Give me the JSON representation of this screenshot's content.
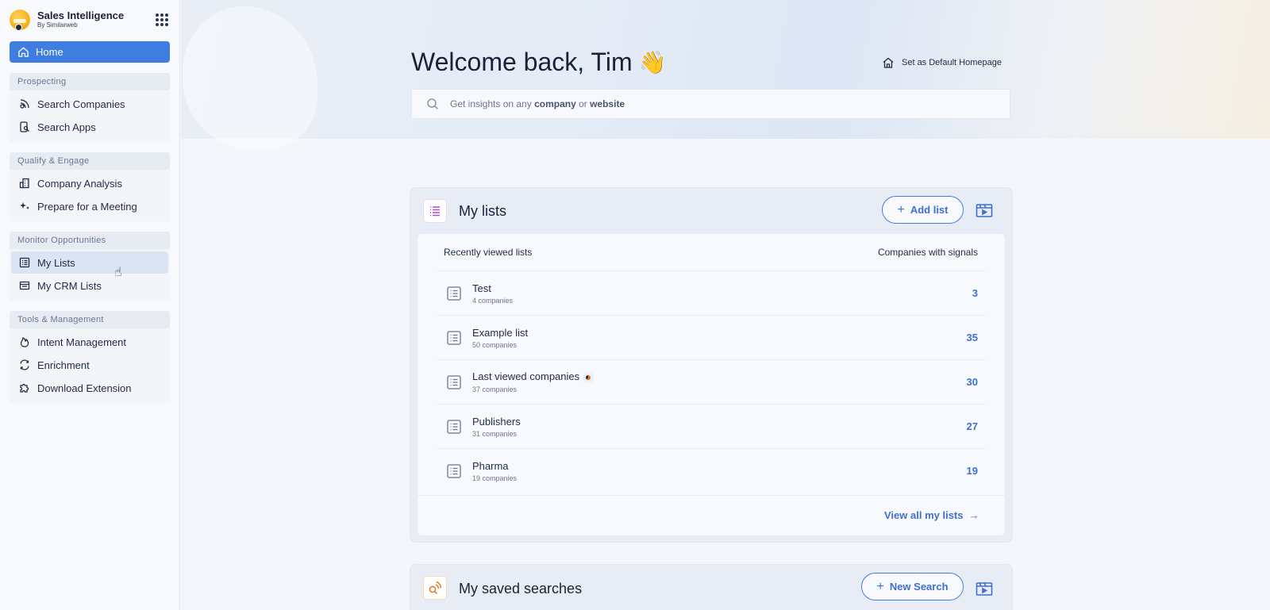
{
  "sidebar": {
    "brand_title": "Sales Intelligence",
    "brand_subtitle": "By Similarweb",
    "home_label": "Home",
    "sections": [
      {
        "title": "Prospecting",
        "items": [
          {
            "label": "Search Companies"
          },
          {
            "label": "Search Apps"
          }
        ]
      },
      {
        "title": "Qualify & Engage",
        "items": [
          {
            "label": "Company Analysis"
          },
          {
            "label": "Prepare for a Meeting"
          }
        ]
      },
      {
        "title": "Monitor Opportunities",
        "items": [
          {
            "label": "My Lists"
          },
          {
            "label": "My CRM Lists"
          }
        ]
      },
      {
        "title": "Tools & Management",
        "items": [
          {
            "label": "Intent Management"
          },
          {
            "label": "Enrichment"
          },
          {
            "label": "Download Extension"
          }
        ]
      }
    ]
  },
  "header": {
    "welcome": "Welcome back, Tim",
    "wave_emoji": "👋",
    "default_homepage_label": "Set as Default Homepage",
    "search_prefix": "Get insights on any ",
    "search_bold1": "company",
    "search_mid": " or ",
    "search_bold2": "website"
  },
  "my_lists": {
    "title": "My lists",
    "add_button": "Add list",
    "col_left": "Recently viewed lists",
    "col_right": "Companies with signals",
    "rows": [
      {
        "name": "Test",
        "sub": "4 companies",
        "count": "3"
      },
      {
        "name": "Example list",
        "sub": "50 companies",
        "count": "35"
      },
      {
        "name": "Last viewed companies",
        "sub": "37 companies",
        "count": "30"
      },
      {
        "name": "Publishers",
        "sub": "31 companies",
        "count": "27"
      },
      {
        "name": "Pharma",
        "sub": "19 companies",
        "count": "19"
      }
    ],
    "view_all": "View all my lists"
  },
  "saved_searches": {
    "title": "My saved searches",
    "new_button": "New Search"
  },
  "colors": {
    "accent": "#3f7de0",
    "link": "#3f6fd0",
    "text": "#1f2a44"
  }
}
